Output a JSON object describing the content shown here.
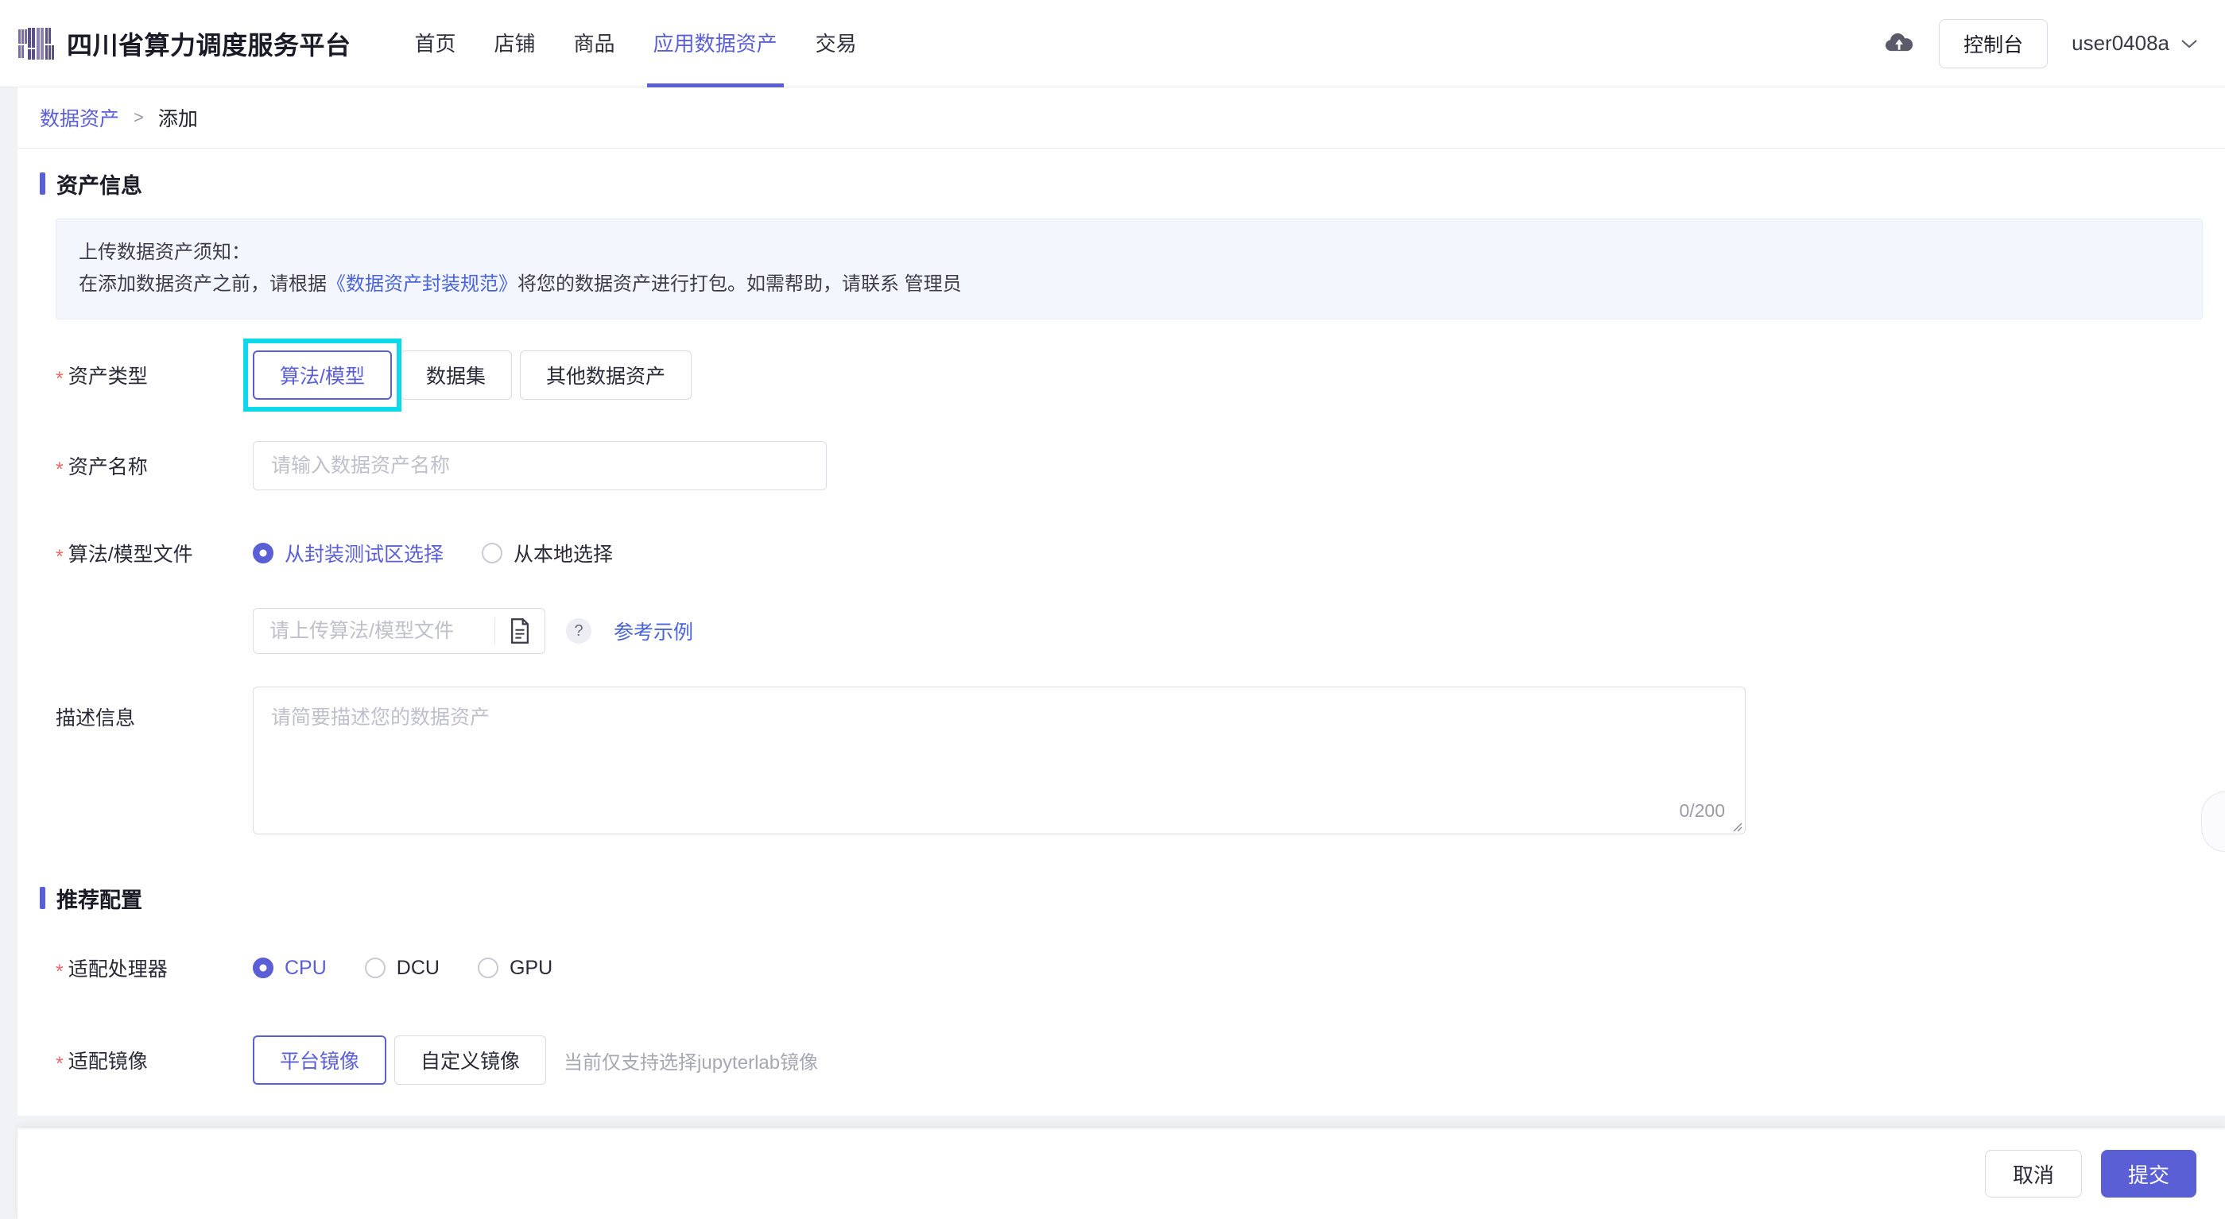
{
  "header": {
    "logo_icon": "platform-bars-logo",
    "brand": "四川省算力调度服务平台",
    "nav": [
      {
        "label": "首页",
        "active": false
      },
      {
        "label": "店铺",
        "active": false
      },
      {
        "label": "商品",
        "active": false
      },
      {
        "label": "应用数据资产",
        "active": true
      },
      {
        "label": "交易",
        "active": false
      }
    ],
    "cloud_icon": "cloud-upload-icon",
    "console_label": "控制台",
    "user_name": "user0408a",
    "user_chevron_icon": "chevron-down-icon"
  },
  "breadcrumb": {
    "root": "数据资产",
    "separator": ">",
    "current": "添加"
  },
  "sections": {
    "asset_info_title": "资产信息",
    "recommend_title": "推荐配置"
  },
  "notice": {
    "line1": "上传数据资产须知：",
    "line2_pre": "在添加数据资产之前，请根据",
    "line2_link": "《数据资产封装规范》",
    "line2_post": "将您的数据资产进行打包。如需帮助，请联系 管理员"
  },
  "fields": {
    "asset_type": {
      "label": "资产类型",
      "required": true,
      "options": [
        "算法/模型",
        "数据集",
        "其他数据资产"
      ],
      "selected": "算法/模型",
      "highlighted": "算法/模型"
    },
    "asset_name": {
      "label": "资产名称",
      "required": true,
      "value": "",
      "placeholder": "请输入数据资产名称"
    },
    "model_file": {
      "label": "算法/模型文件",
      "required": true,
      "radios": [
        {
          "label": "从封装测试区选择",
          "selected": true
        },
        {
          "label": "从本地选择",
          "selected": false
        }
      ],
      "file_value": "",
      "file_placeholder": "请上传算法/模型文件",
      "file_icon": "document-file-icon",
      "help_icon": "question-mark-icon",
      "reference_link": "参考示例"
    },
    "description": {
      "label": "描述信息",
      "required": false,
      "value": "",
      "placeholder": "请简要描述您的数据资产",
      "counter": "0/200"
    },
    "processor": {
      "label": "适配处理器",
      "required": true,
      "radios": [
        {
          "label": "CPU",
          "selected": true
        },
        {
          "label": "DCU",
          "selected": false
        },
        {
          "label": "GPU",
          "selected": false
        }
      ]
    },
    "image": {
      "label": "适配镜像",
      "required": true,
      "options": [
        "平台镜像",
        "自定义镜像"
      ],
      "selected": "平台镜像",
      "hint": "当前仅支持选择jupyterlab镜像"
    }
  },
  "footer": {
    "cancel_label": "取消",
    "submit_label": "提交"
  },
  "side_tab": {
    "icon": "side-panel-handle"
  },
  "colors": {
    "primary": "#5b5fd6",
    "highlight": "#0fd8e8",
    "required": "#e86b6b",
    "page_bg": "#f0f2f5",
    "notice_bg": "#f3f7fd"
  }
}
